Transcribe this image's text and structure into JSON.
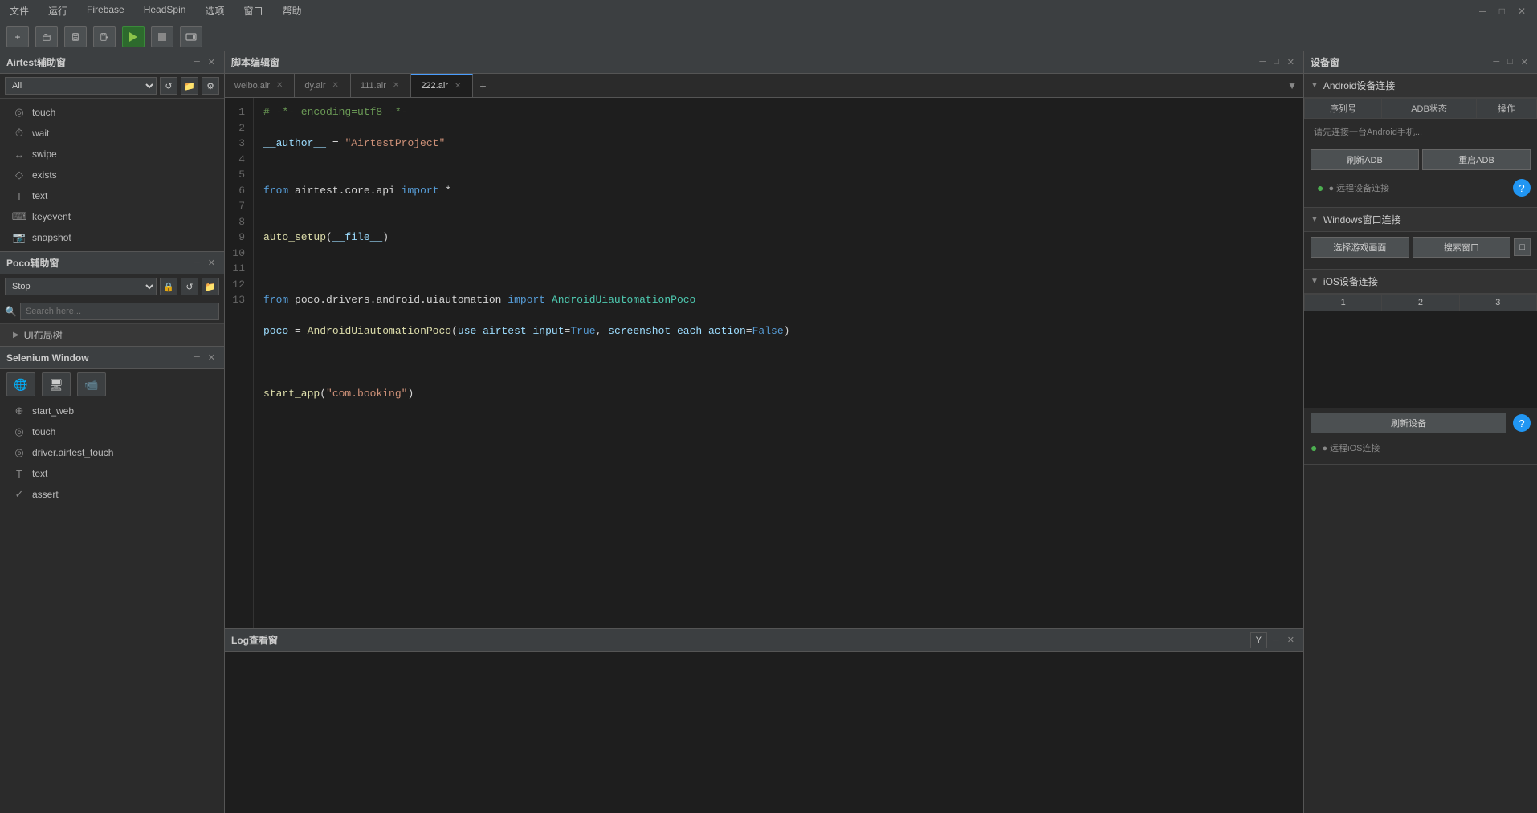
{
  "menubar": {
    "items": [
      "文件",
      "运行",
      "Firebase",
      "HeadSpin",
      "选项",
      "窗口",
      "帮助"
    ]
  },
  "toolbar": {
    "new_label": "+",
    "open_label": "📂",
    "save_label": "💾",
    "saveas_label": "💾",
    "run_label": "▶",
    "stop_label": "■",
    "record_label": "⏺"
  },
  "airtest_panel": {
    "title": "Airtest辅助窗",
    "filter_default": "All",
    "filter_options": [
      "All",
      "touch",
      "wait",
      "swipe",
      "exists",
      "text",
      "keyevent",
      "snapshot"
    ],
    "items": [
      {
        "icon": "◎",
        "label": "touch"
      },
      {
        "icon": "⏱",
        "label": "wait"
      },
      {
        "icon": "↔",
        "label": "swipe"
      },
      {
        "icon": "◇",
        "label": "exists"
      },
      {
        "icon": "T",
        "label": "text"
      },
      {
        "icon": "⌨",
        "label": "keyevent"
      },
      {
        "icon": "📷",
        "label": "snapshot"
      }
    ]
  },
  "poco_panel": {
    "title": "Poco辅助窗",
    "select_default": "Stop",
    "search_placeholder": "Search here...",
    "tree_item": "UI布局树"
  },
  "selenium_panel": {
    "title": "Selenium Window",
    "items": [
      {
        "icon": "🌐",
        "label": "start_web"
      },
      {
        "icon": "◎",
        "label": "touch"
      },
      {
        "icon": "◎",
        "label": "driver.airtest_touch"
      },
      {
        "icon": "T",
        "label": "text"
      },
      {
        "icon": "✓",
        "label": "assert"
      }
    ]
  },
  "editor": {
    "title": "脚本编辑窗",
    "tabs": [
      {
        "label": "weibo.air",
        "active": false
      },
      {
        "label": "dy.air",
        "active": false
      },
      {
        "label": "111.air",
        "active": false
      },
      {
        "label": "222.air",
        "active": true
      }
    ],
    "code_lines": [
      "# -*- encoding=utf8 -*-",
      "__author__ = \"AirtestProject\"",
      "",
      "from airtest.core.api import *",
      "",
      "auto_setup(__file__)",
      "",
      "",
      "from poco.drivers.android.uiautomation import AndroidUiautomationPoco",
      "poco = AndroidUiautomationPoco(use_airtest_input=True, screenshot_each_action=False)",
      "",
      "",
      "start_app(\"com.booking\")"
    ]
  },
  "log_panel": {
    "title": "Log查看窗"
  },
  "device_panel": {
    "title": "设备窗",
    "android_section": {
      "title": "Android设备连接",
      "columns": [
        "序列号",
        "ADB状态",
        "操作"
      ],
      "connect_msg": "请先连接一台Android手机...",
      "refresh_btn": "刷新ADB",
      "reset_btn": "重启ADB",
      "remote_label": "● 远程设备连接"
    },
    "windows_section": {
      "title": "Windows窗口连接",
      "game_btn": "选择游戏画面",
      "search_btn": "搜索窗口"
    },
    "ios_section": {
      "title": "iOS设备连接",
      "columns": [
        "1",
        "2",
        "3"
      ],
      "refresh_btn": "刷新设备",
      "remote_label": "● 远程iOS连接"
    }
  }
}
